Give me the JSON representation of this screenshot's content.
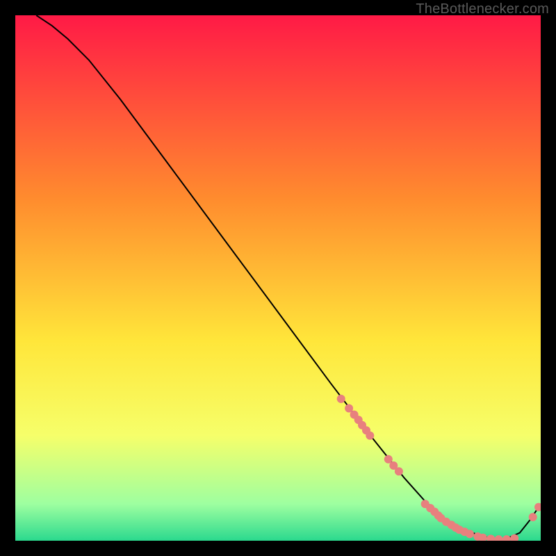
{
  "watermark": "TheBottlenecker.com",
  "colors": {
    "bg": "#000000",
    "curve": "#000000",
    "dot": "#e8807e",
    "gradient_top": "#ff1a46",
    "gradient_mid1": "#ff8c2e",
    "gradient_mid2": "#ffe63a",
    "gradient_low": "#f6ff6a",
    "gradient_bottom1": "#9effa0",
    "gradient_bottom2": "#2bd98e"
  },
  "chart_data": {
    "type": "line",
    "title": "",
    "xlabel": "",
    "ylabel": "",
    "xlim": [
      0,
      100
    ],
    "ylim": [
      0,
      100
    ],
    "curve": {
      "x": [
        4,
        7,
        10,
        14,
        20,
        30,
        40,
        50,
        60,
        68,
        74,
        78,
        82,
        86,
        90,
        93,
        96,
        98,
        100
      ],
      "y": [
        100,
        98,
        95.5,
        91.5,
        84,
        70.5,
        57,
        43.5,
        30,
        19.5,
        12,
        7.5,
        4,
        1.8,
        0.6,
        0.2,
        1.5,
        4,
        7
      ]
    },
    "series": [
      {
        "name": "data-points",
        "x": [
          62,
          63.5,
          64.5,
          65.3,
          66,
          66.8,
          67.5,
          71,
          72,
          73,
          78,
          79,
          79.8,
          80.5,
          81,
          82,
          83,
          83.8,
          84.5,
          85.5,
          86.5,
          88,
          89,
          90.5,
          92,
          93.5,
          95,
          98.5,
          99.6
        ],
        "y": [
          27,
          25.2,
          24,
          23,
          22,
          21,
          20,
          15.5,
          14.3,
          13.2,
          7,
          6.2,
          5.5,
          4.8,
          4.3,
          3.6,
          3,
          2.5,
          2.1,
          1.7,
          1.3,
          0.8,
          0.55,
          0.35,
          0.25,
          0.25,
          0.45,
          4.5,
          6.4
        ]
      }
    ]
  }
}
